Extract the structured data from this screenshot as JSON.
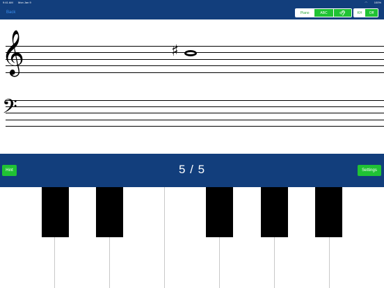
{
  "status_bar": {
    "time": "9:41 AM",
    "date": "Mon Jan 9",
    "battery": "100%"
  },
  "nav": {
    "back_label": "Back",
    "mode_segments": [
      "Piano",
      "ABC"
    ],
    "mode_selected": "ABC",
    "toggle_segments": [
      "KH",
      "Off"
    ],
    "toggle_selected": "Off"
  },
  "notation": {
    "note_accidental": "♯",
    "treble_clef": "𝄞",
    "bass_clef": "𝄢"
  },
  "controls": {
    "hint_label": "Hint",
    "progress": "5 / 5",
    "settings_label": "Settings"
  },
  "colors": {
    "nav_bg": "#123e7c",
    "accent_green": "#20c234",
    "link_blue": "#3b8ff0"
  },
  "icons": {
    "ear": "ear-icon",
    "wifi": "wifi-icon"
  }
}
